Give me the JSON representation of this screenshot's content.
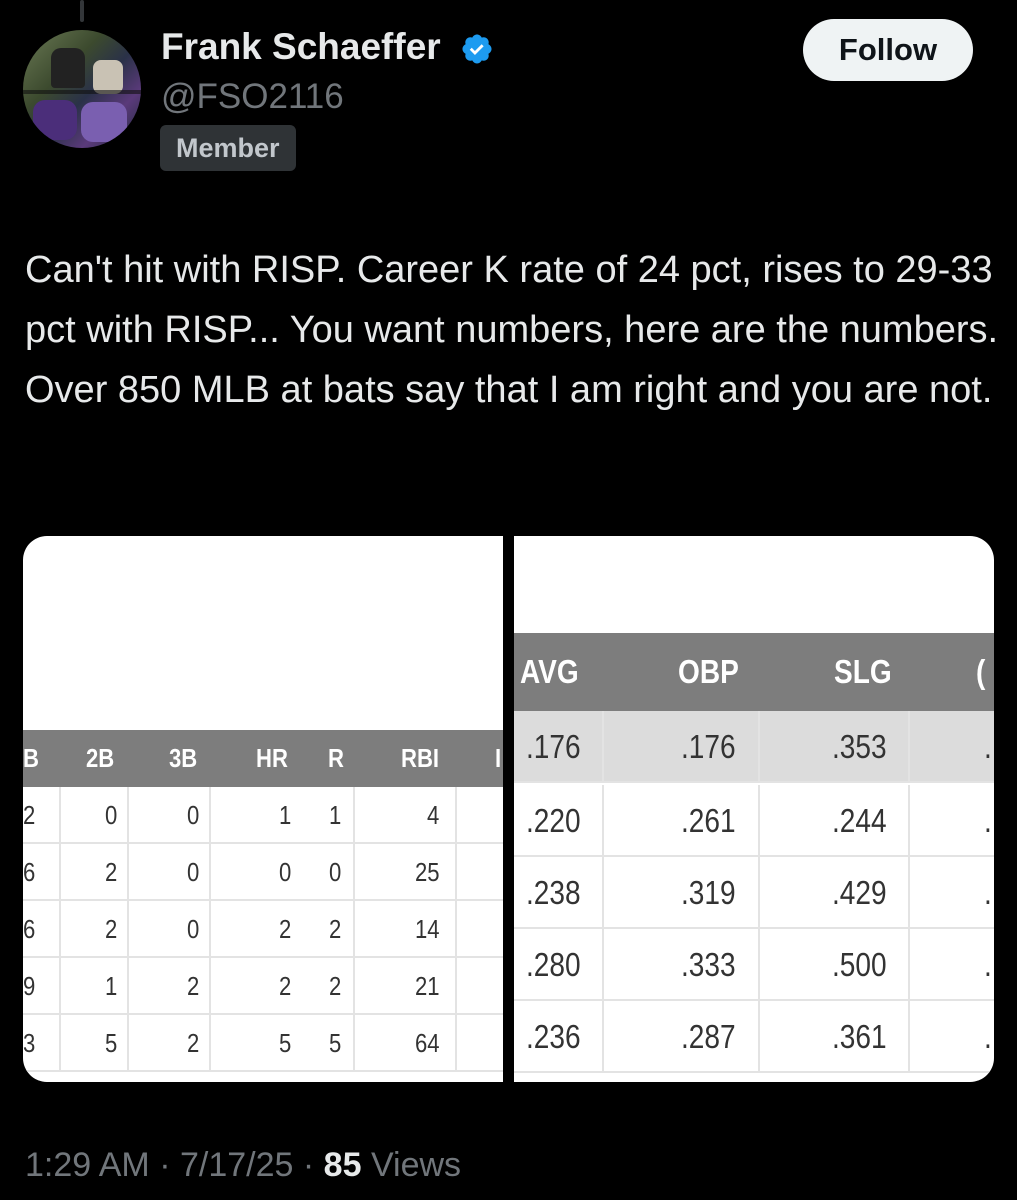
{
  "author": {
    "name": "Frank Schaeffer",
    "handle": "@FSO2116",
    "badge": "Member",
    "verified": true
  },
  "follow_label": "Follow",
  "tweet_text": "Can't hit with RISP. Career K rate of 24 pct, rises to 29-33 pct with RISP... You want numbers, here are the numbers. Over 850 MLB at bats say that I am right and you are not.",
  "left_table": {
    "headers": [
      "B",
      "2B",
      "3B",
      "HR",
      "R",
      "RBI",
      "I"
    ],
    "rows": [
      [
        "2",
        "0",
        "0",
        "1",
        "1",
        "4"
      ],
      [
        "6",
        "2",
        "0",
        "0",
        "0",
        "25"
      ],
      [
        "6",
        "2",
        "0",
        "2",
        "2",
        "14"
      ],
      [
        "9",
        "1",
        "2",
        "2",
        "2",
        "21"
      ],
      [
        "3",
        "5",
        "2",
        "5",
        "5",
        "64"
      ]
    ]
  },
  "right_table": {
    "headers": [
      "AVG",
      "OBP",
      "SLG",
      "("
    ],
    "rows": [
      [
        ".176",
        ".176",
        ".353",
        "."
      ],
      [
        ".220",
        ".261",
        ".244",
        "."
      ],
      [
        ".238",
        ".319",
        ".429",
        "."
      ],
      [
        ".280",
        ".333",
        ".500",
        "."
      ],
      [
        ".236",
        ".287",
        ".361",
        "."
      ]
    ]
  },
  "footer": {
    "time": "1:29 AM",
    "date": "7/17/25",
    "views_count": "85",
    "views_label": "Views",
    "separator": "·"
  },
  "colors": {
    "background": "#000000",
    "text": "#e7e9ea",
    "muted": "#71767b",
    "verified": "#1d9bf0",
    "table_header": "#7d7d7d"
  }
}
